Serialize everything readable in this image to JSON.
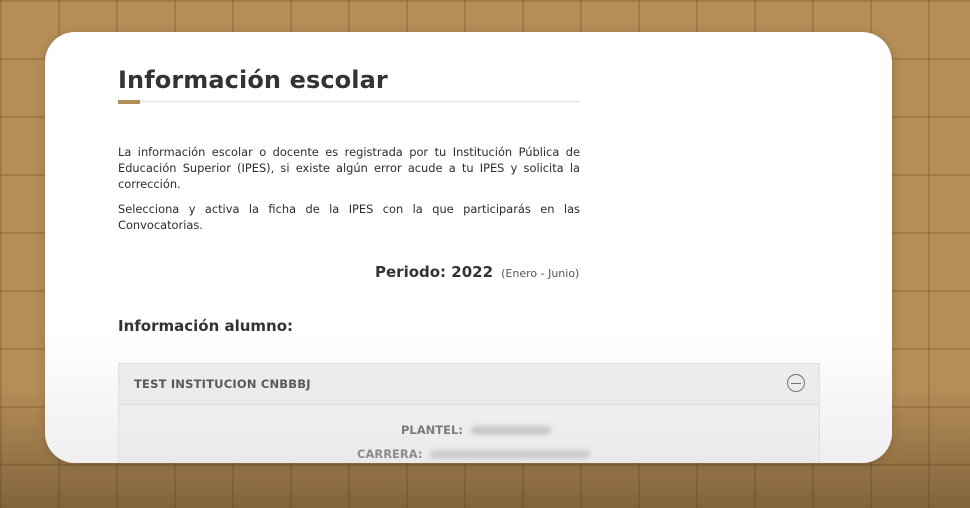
{
  "page": {
    "title": "Información escolar",
    "intro_paragraph": "La información escolar o docente es registrada por tu Institución Pública de Educación Superior (IPES), si existe algún error acude a tu IPES y solicita la corrección.",
    "instruction_paragraph": "Selecciona y activa la ficha de la IPES con la que participarás en las Convocatorias.",
    "period_label": "Periodo: 2022",
    "period_range": "(Enero - Junio)",
    "section_title": "Información alumno:"
  },
  "institution_panel": {
    "name": "TEST INSTITUCION CNBBBJ",
    "expanded": true,
    "fields": [
      {
        "label": "PLANTEL:",
        "value_redacted": true
      },
      {
        "label": "CARRERA:",
        "value_redacted": true
      }
    ]
  },
  "colors": {
    "accent": "#b38e5d",
    "background": "#b48d57",
    "text": "#333333"
  },
  "icons": {
    "collapse": "minus-circle-icon"
  }
}
